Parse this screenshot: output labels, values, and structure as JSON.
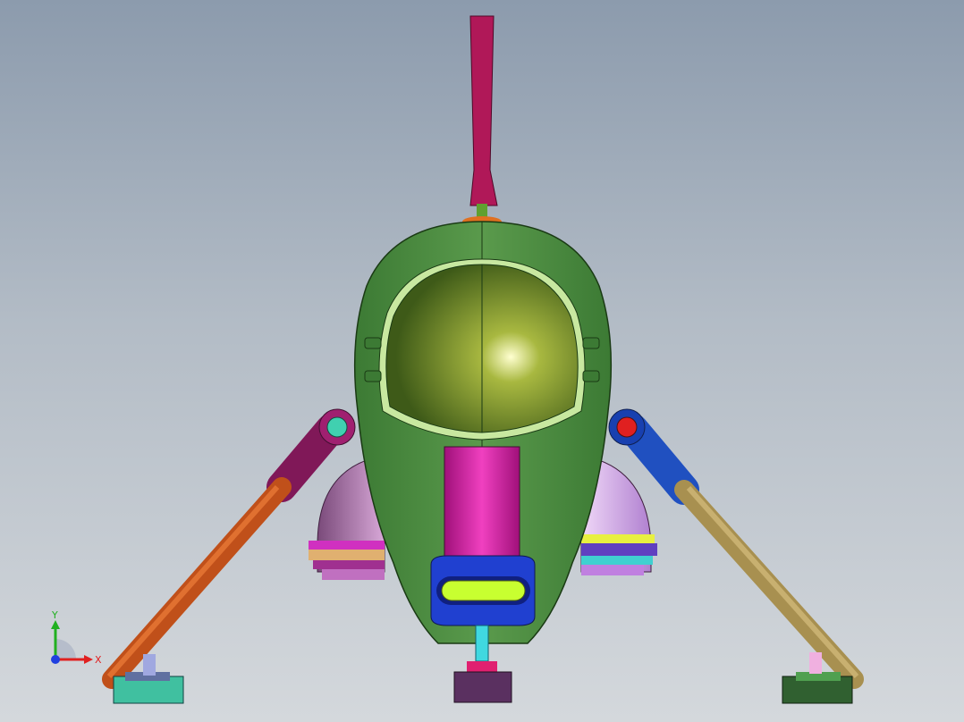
{
  "viewport": {
    "background_top": "#8c9bad",
    "background_bottom": "#d4d8dc"
  },
  "triad": {
    "x_label": "X",
    "y_label": "Y",
    "x_color": "#e02020",
    "y_color": "#20b020",
    "z_color": "#2040e0"
  },
  "model": {
    "body_color": "#4a8a40",
    "canopy_color": "#5a7a20",
    "antenna_color": "#b01858",
    "center_stripe_color": "#d020a0",
    "front_light_color": "#c8ff30",
    "left_leg_upper_color": "#801858",
    "left_leg_lower_color": "#c0501a",
    "right_leg_upper_color": "#2050c0",
    "right_leg_lower_color": "#a89050",
    "left_joint_color": "#40d0b0",
    "right_joint_color": "#e02020"
  }
}
